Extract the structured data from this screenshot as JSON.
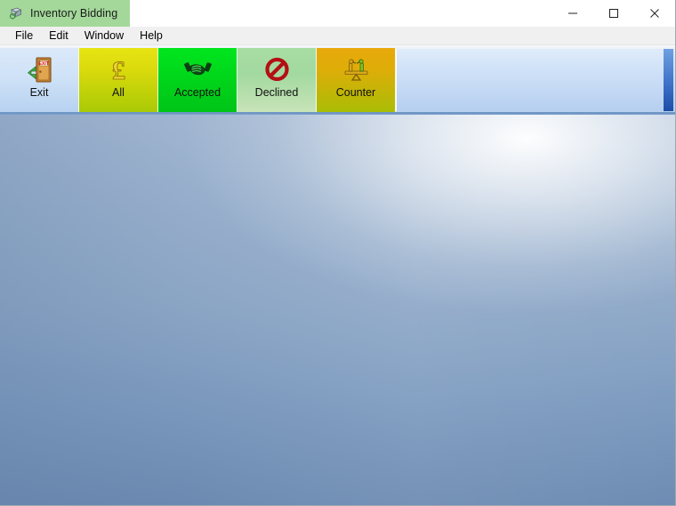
{
  "window": {
    "title": "Inventory Bidding",
    "app_icon": "inventory-bidding-icon",
    "controls": {
      "minimize_label": "Minimize",
      "maximize_label": "Maximize",
      "close_label": "Close"
    }
  },
  "menubar": {
    "items": [
      {
        "label": "File",
        "name": "menu-file"
      },
      {
        "label": "Edit",
        "name": "menu-edit"
      },
      {
        "label": "Window",
        "name": "menu-window"
      },
      {
        "label": "Help",
        "name": "menu-help"
      }
    ]
  },
  "toolbar": {
    "buttons": [
      {
        "label": "Exit",
        "icon": "exit-door-icon",
        "color": "#cfe2f7"
      },
      {
        "label": "All",
        "icon": "pound-sterling-icon",
        "color": "#d9da0c"
      },
      {
        "label": "Accepted",
        "icon": "handshake-icon",
        "color": "#00d81b"
      },
      {
        "label": "Declined",
        "icon": "prohibition-icon",
        "color": "#a2d9a0"
      },
      {
        "label": "Counter",
        "icon": "balance-scale-icon",
        "color": "#ddad08"
      }
    ]
  },
  "workspace": {
    "background_top": "#a8bcd6",
    "background_bottom": "#6e8cb3",
    "content": ""
  }
}
